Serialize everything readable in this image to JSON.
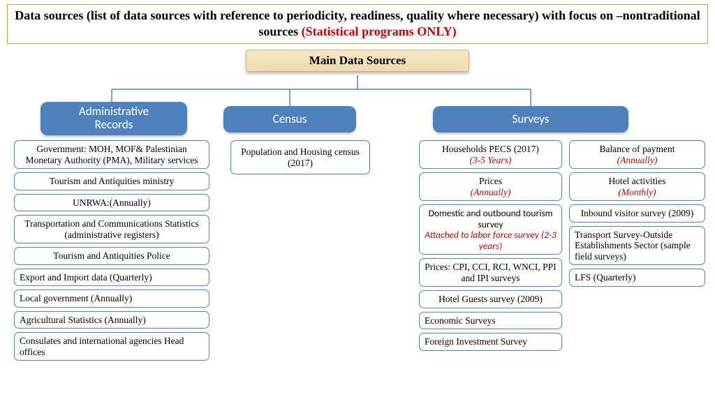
{
  "title": {
    "main": "Data sources (list of data sources with reference to periodicity, readiness, quality where necessary) with focus on –nontraditional sources  ",
    "highlight": "(Statistical programs ONLY)"
  },
  "root": "Main Data Sources",
  "categories": {
    "admin": "Administrative Records",
    "census": "Census",
    "surveys": "Surveys"
  },
  "admin_items": [
    "Government:  MOH, MOF& Palestinian Monetary Authority (PMA), Military services",
    "Tourism and Antiquities ministry",
    "UNRWA:(Annually)",
    "Transportation and Communications Statistics (administrative registers)",
    "Tourism and Antiquities Police",
    "Export and Import data (Quarterly)",
    "Local government (Annually)",
    "Agricultural Statistics (Annually)",
    "Consulates and international agencies Head offices"
  ],
  "census_items": [
    "Population and Housing census (2017)"
  ],
  "surveys_a": [
    {
      "t": "Households PECS (2017)",
      "n": "(3-5 Years)"
    },
    {
      "t": "Prices",
      "n": "(Annually)"
    },
    {
      "t": "Domestic and  outbound tourism survey",
      "n": "Attached to labor force survey (2-3 years)"
    },
    {
      "t": "Prices: CPI, CCI, RCI, WNCI, PPI and IPI surveys",
      "n": ""
    },
    {
      "t": "Hotel Guests survey (2009)",
      "n": ""
    },
    {
      "t": "Economic Surveys",
      "n": ""
    },
    {
      "t": "Foreign Investment Survey",
      "n": ""
    }
  ],
  "surveys_b": [
    {
      "t": "Balance of payment",
      "n": "(Annually)"
    },
    {
      "t": "Hotel activities",
      "n": "(Monthly)"
    },
    {
      "t": "Inbound visitor survey (2009)",
      "n": ""
    },
    {
      "t": "Transport Survey-Outside Establishments Sector (sample field surveys)",
      "n": ""
    },
    {
      "t": "LFS (Quarterly)",
      "n": ""
    }
  ]
}
